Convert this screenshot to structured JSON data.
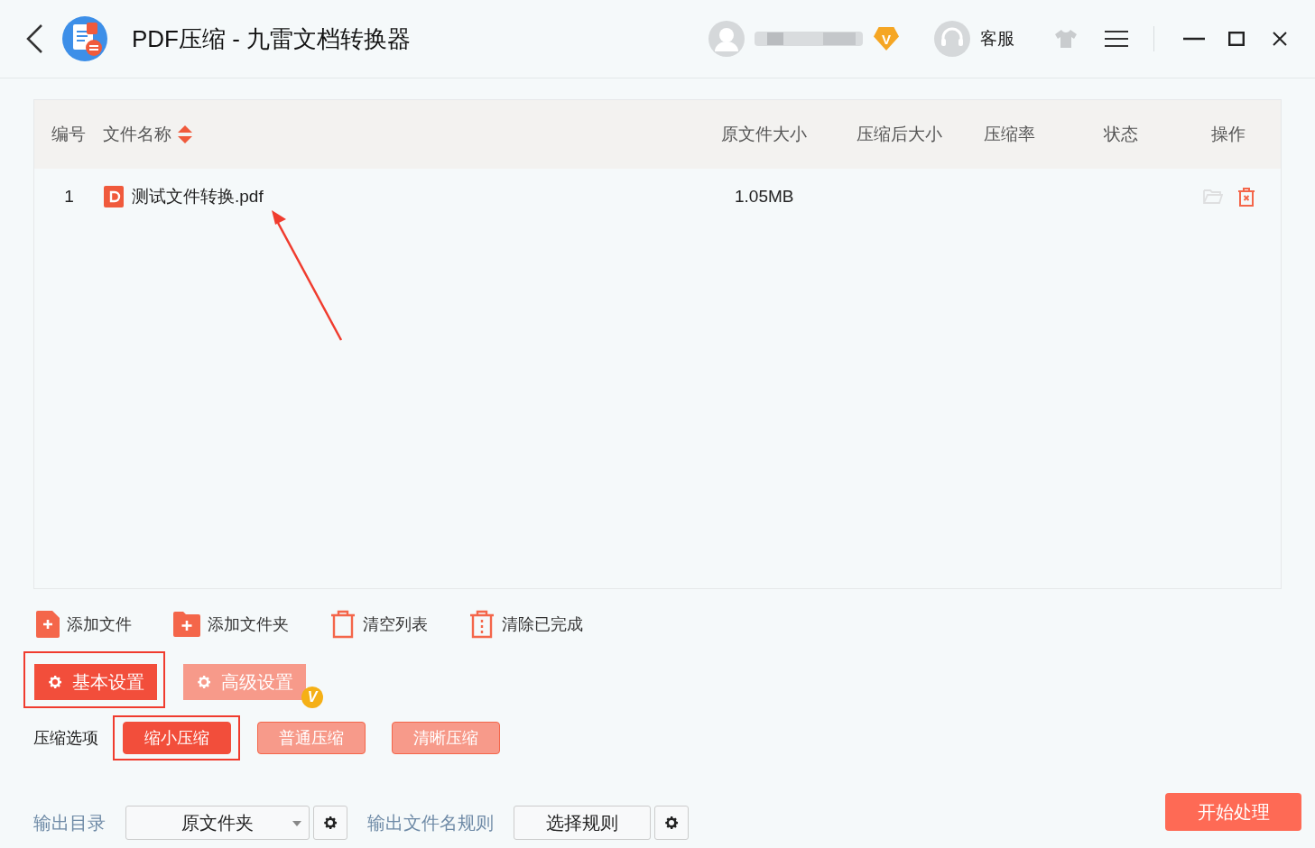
{
  "window": {
    "title": "PDF压缩 - 九雷文档转换器",
    "vip_badge": "V",
    "support_label": "客服"
  },
  "table": {
    "columns": [
      "编号",
      "文件名称",
      "原文件大小",
      "压缩后大小",
      "压缩率",
      "状态",
      "操作"
    ],
    "rows": [
      {
        "number": "1",
        "file_name": "测试文件转换.pdf",
        "original_size": "1.05MB"
      }
    ]
  },
  "toolbar": [
    {
      "kind": "add-file",
      "label": "添加文件"
    },
    {
      "kind": "add-folder",
      "label": "添加文件夹"
    },
    {
      "kind": "clear",
      "label": "清空列表"
    },
    {
      "kind": "clear-done",
      "label": "清除已完成"
    }
  ],
  "settings_tabs": [
    {
      "label": "基本设置",
      "selected": true,
      "annotated": true
    },
    {
      "label": "高级设置",
      "selected": false,
      "annotated": false,
      "badge": "V"
    }
  ],
  "compression": {
    "label": "压缩选项",
    "options": [
      {
        "label": "缩小压缩",
        "selected": true,
        "annotated": true
      },
      {
        "label": "普通压缩",
        "selected": false,
        "annotated": false
      },
      {
        "label": "清晰压缩",
        "selected": false,
        "annotated": false
      }
    ]
  },
  "output": {
    "dir_label": "输出目录",
    "dir_value": "原文件夹",
    "name_rule_label": "输出文件名规则",
    "name_rule_button": "选择规则"
  },
  "start_button": "开始处理"
}
